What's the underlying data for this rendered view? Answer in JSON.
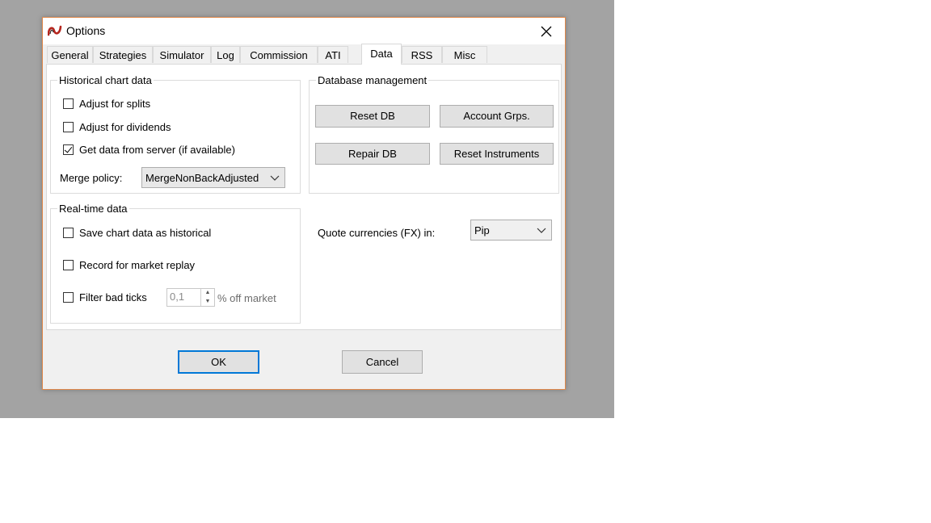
{
  "dialog": {
    "title": "Options",
    "icon": "app-logo-icon",
    "close_icon": "close-icon"
  },
  "tabs": [
    {
      "label": "General"
    },
    {
      "label": "Strategies"
    },
    {
      "label": "Simulator"
    },
    {
      "label": "Log"
    },
    {
      "label": "Commission"
    },
    {
      "label": "ATI"
    },
    {
      "label": "Data",
      "selected": true
    },
    {
      "label": "RSS"
    },
    {
      "label": "Misc"
    }
  ],
  "historical": {
    "title": "Historical chart data",
    "adjust_splits": {
      "label": "Adjust for splits",
      "checked": false
    },
    "adjust_dividends": {
      "label": "Adjust for dividends",
      "checked": false
    },
    "get_server_data": {
      "label": "Get data from server (if available)",
      "checked": true
    },
    "merge_policy_label": "Merge policy:",
    "merge_policy_value": "MergeNonBackAdjusted"
  },
  "database": {
    "title": "Database management",
    "reset_db": "Reset DB",
    "account_grps": "Account Grps.",
    "repair_db": "Repair DB",
    "reset_instruments": "Reset Instruments"
  },
  "realtime": {
    "title": "Real-time data",
    "save_chart": {
      "label": "Save chart data as historical",
      "checked": false
    },
    "record_replay": {
      "label": "Record for market replay",
      "checked": false
    },
    "filter_bad_ticks": {
      "label": "Filter bad ticks",
      "checked": false
    },
    "filter_value": "0,1",
    "filter_suffix": "% off market"
  },
  "quote": {
    "label": "Quote currencies (FX) in:",
    "value": "Pip"
  },
  "footer": {
    "ok": "OK",
    "cancel": "Cancel"
  },
  "colors": {
    "backdrop": "#a3a3a3",
    "dialog_border": "#e0884a",
    "default_button_border": "#0078d7"
  }
}
